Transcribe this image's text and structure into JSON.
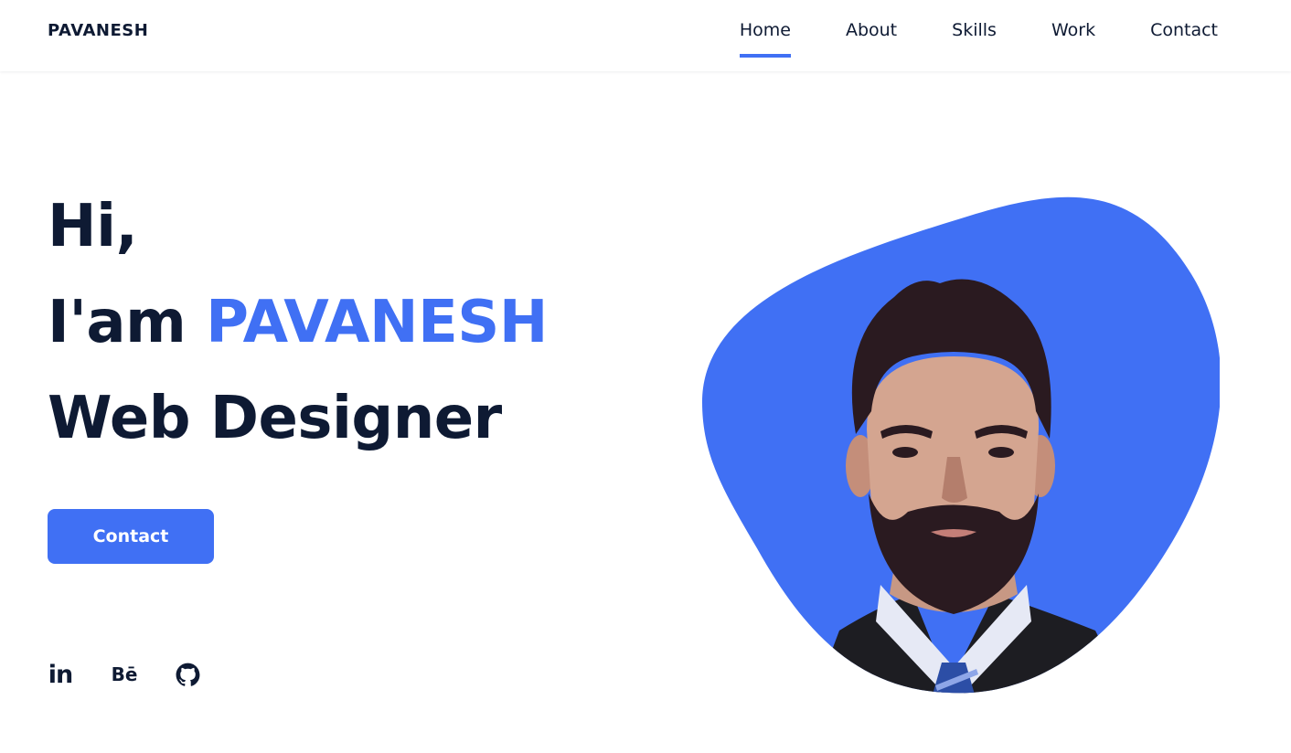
{
  "header": {
    "logo": "PAVANESH",
    "nav": [
      {
        "label": "Home",
        "active": true
      },
      {
        "label": "About",
        "active": false
      },
      {
        "label": "Skills",
        "active": false
      },
      {
        "label": "Work",
        "active": false
      },
      {
        "label": "Contact",
        "active": false
      }
    ]
  },
  "hero": {
    "greeting": "Hi,",
    "intro_prefix": "I'am ",
    "name": "PAVANESH",
    "role": "Web Designer",
    "button_label": "Contact"
  },
  "social": [
    {
      "label": "in",
      "icon": "linkedin-icon"
    },
    {
      "label": "Bē",
      "icon": "behance-icon"
    },
    {
      "label": "",
      "icon": "github-icon"
    }
  ],
  "colors": {
    "accent": "#4070f4",
    "text": "#0e1a33",
    "background": "#ffffff"
  }
}
